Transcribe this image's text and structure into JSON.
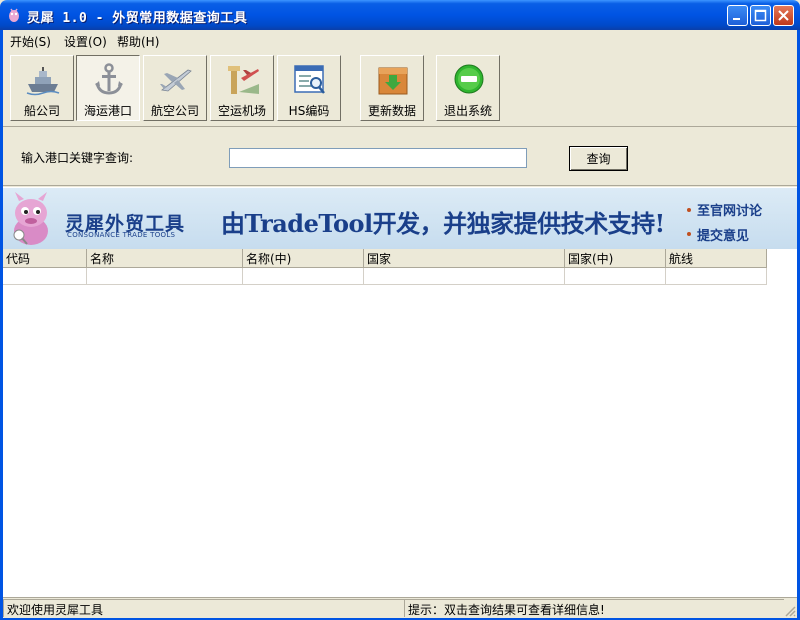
{
  "window": {
    "title": "灵犀 1.0 - 外贸常用数据查询工具"
  },
  "menu": [
    {
      "label": "开始(S)"
    },
    {
      "label": "设置(O)"
    },
    {
      "label": "帮助(H)"
    }
  ],
  "toolbar": [
    {
      "label": "船公司",
      "icon": "ship-icon"
    },
    {
      "label": "海运港口",
      "icon": "anchor-icon",
      "pressed": true
    },
    {
      "label": "航空公司",
      "icon": "airplane-icon"
    },
    {
      "label": "空运机场",
      "icon": "airport-icon"
    },
    {
      "label": "HS编码",
      "icon": "hs-code-window-icon"
    },
    {
      "label": "更新数据",
      "icon": "update-box-icon"
    },
    {
      "label": "退出系统",
      "icon": "exit-icon"
    }
  ],
  "search": {
    "label": "输入港口关键字查询:",
    "value": "",
    "button_label": "查询"
  },
  "banner": {
    "brand_cn": "灵犀外贸工具",
    "brand_en": "CONSONANCE TRADE TOOLS",
    "slogan": "由TradeTool开发，并独家提供技术支持!",
    "links": [
      "至官网讨论",
      "提交意见"
    ]
  },
  "table": {
    "columns": [
      "代码",
      "名称",
      "名称(中)",
      "国家",
      "国家(中)",
      "航线"
    ],
    "rows": []
  },
  "status": {
    "left": "欢迎使用灵犀工具",
    "right": "提示：双击查询结果可查看详细信息!"
  },
  "colors": {
    "titlebar": "#0054E3",
    "face": "#ECE9D8",
    "brand": "#1A3F8A"
  }
}
